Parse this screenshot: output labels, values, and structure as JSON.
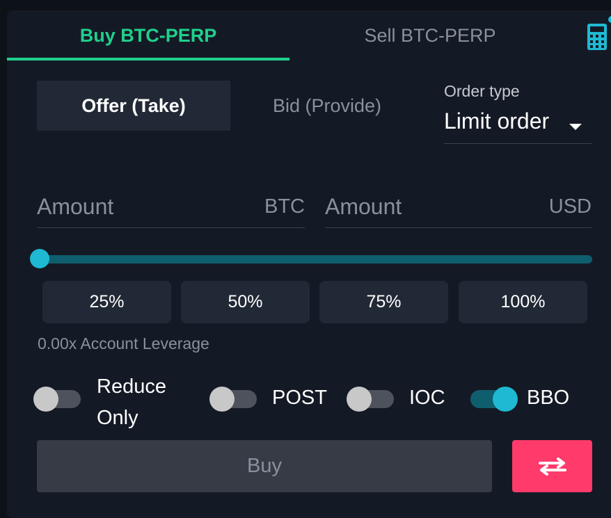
{
  "tabs": {
    "buy": "Buy BTC-PERP",
    "sell": "Sell BTC-PERP"
  },
  "mode": {
    "offer": "Offer (Take)",
    "bid": "Bid (Provide)"
  },
  "order_type": {
    "label": "Order type",
    "value": "Limit order"
  },
  "amount_base": {
    "placeholder": "Amount",
    "unit": "BTC"
  },
  "amount_quote": {
    "placeholder": "Amount",
    "unit": "USD"
  },
  "slider": {
    "value_percent": 0
  },
  "percent_buttons": [
    "25%",
    "50%",
    "75%",
    "100%"
  ],
  "leverage_text": "0.00x Account Leverage",
  "toggles": {
    "reduce_only": {
      "label": "Reduce Only",
      "on": false
    },
    "post": {
      "label": "POST",
      "on": false
    },
    "ioc": {
      "label": "IOC",
      "on": false
    },
    "bbo": {
      "label": "BBO",
      "on": true
    }
  },
  "submit_label": "Buy",
  "colors": {
    "accent_green": "#1fd08c",
    "accent_cyan": "#1fb9d3",
    "swap_red": "#ff3b6b"
  },
  "icons": {
    "calculator": "calculator-icon",
    "swap": "swap-arrows-icon"
  }
}
